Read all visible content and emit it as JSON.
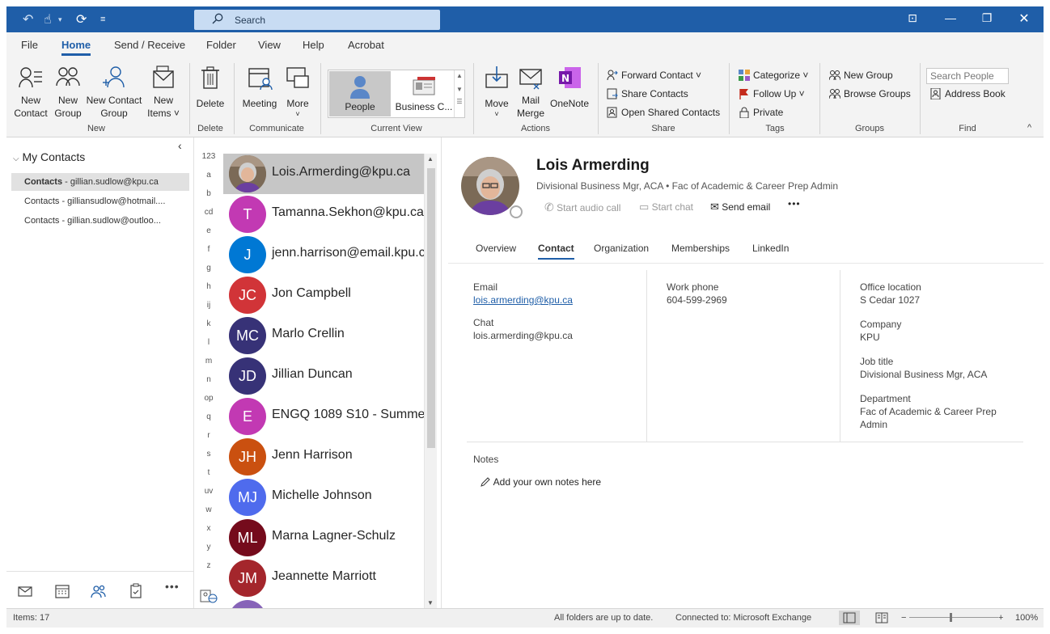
{
  "titlebar": {
    "search_placeholder": "Search"
  },
  "tabs": [
    "File",
    "Home",
    "Send / Receive",
    "Folder",
    "View",
    "Help",
    "Acrobat"
  ],
  "ribbon": {
    "new": {
      "new_contact": [
        "New",
        "Contact"
      ],
      "new_group": [
        "New",
        "Group"
      ],
      "new_contact_group": [
        "New Contact",
        "Group"
      ],
      "new_items": [
        "New",
        "Items ˅"
      ],
      "label": "New"
    },
    "delete": {
      "button": "Delete",
      "label": "Delete"
    },
    "communicate": {
      "meeting": "Meeting",
      "more": "More",
      "more_chevron": "˅",
      "label": "Communicate"
    },
    "current_view": {
      "people": "People",
      "business": "Business C...",
      "label": "Current View"
    },
    "actions": {
      "move": "Move",
      "move_chevron": "˅",
      "mail_merge": [
        "Mail",
        "Merge"
      ],
      "onenote": "OneNote",
      "label": "Actions"
    },
    "share": {
      "forward_contact": "Forward Contact ˅",
      "share_contacts": "Share Contacts",
      "open_shared": "Open Shared Contacts",
      "label": "Share"
    },
    "tags": {
      "categorize": "Categorize ˅",
      "follow_up": "Follow Up ˅",
      "private": "Private",
      "label": "Tags"
    },
    "groups": {
      "new_group": "New Group",
      "browse_groups": "Browse Groups",
      "label": "Groups"
    },
    "find": {
      "search_people": "Search People",
      "address_book": "Address Book",
      "label": "Find"
    },
    "collapse": "^"
  },
  "folder_pane": {
    "collapse_icon": "‹",
    "title": "My Contacts",
    "items": [
      {
        "bold": "Contacts",
        "rest": " - gillian.sudlow@kpu.ca",
        "selected": true
      },
      {
        "bold": "",
        "rest": "Contacts - gilliansudlow@hotmail....",
        "selected": false
      },
      {
        "bold": "",
        "rest": "Contacts - gillian.sudlow@outloo...",
        "selected": false
      }
    ]
  },
  "alpha_index": [
    "123",
    "a",
    "b",
    "cd",
    "e",
    "f",
    "g",
    "h",
    "ij",
    "k",
    "l",
    "m",
    "n",
    "op",
    "q",
    "r",
    "s",
    "t",
    "uv",
    "w",
    "x",
    "y",
    "z"
  ],
  "contacts": [
    {
      "initials": "",
      "name": "Lois.Armerding@kpu.ca",
      "color": "#8a7a6a",
      "photo": true,
      "selected": true
    },
    {
      "initials": "T",
      "name": "Tamanna.Sekhon@kpu.ca",
      "color": "#c239b3",
      "photo": false,
      "selected": false
    },
    {
      "initials": "J",
      "name": "jenn.harrison@email.kpu.ca",
      "color": "#0078d4",
      "photo": false,
      "selected": false
    },
    {
      "initials": "JC",
      "name": "Jon Campbell",
      "color": "#d13438",
      "photo": false,
      "selected": false
    },
    {
      "initials": "MC",
      "name": "Marlo Crellin",
      "color": "#373277",
      "photo": false,
      "selected": false
    },
    {
      "initials": "JD",
      "name": "Jillian Duncan",
      "color": "#373277",
      "photo": false,
      "selected": false
    },
    {
      "initials": "E",
      "name": "ENGQ 1089 S10 - Summer",
      "color": "#c239b3",
      "photo": false,
      "selected": false
    },
    {
      "initials": "JH",
      "name": "Jenn Harrison",
      "color": "#ca5010",
      "photo": false,
      "selected": false
    },
    {
      "initials": "MJ",
      "name": "Michelle Johnson",
      "color": "#4f6bed",
      "photo": false,
      "selected": false
    },
    {
      "initials": "ML",
      "name": "Marna Lagner-Schulz",
      "color": "#750b1c",
      "photo": false,
      "selected": false
    },
    {
      "initials": "JM",
      "name": "Jeannette Marriott",
      "color": "#a4262c",
      "photo": false,
      "selected": false
    },
    {
      "initials": "",
      "name": "",
      "color": "#8764b8",
      "photo": false,
      "selected": false
    }
  ],
  "contact_card": {
    "name": "Lois Armerding",
    "subtitle": "Divisional Business Mgr, ACA • Fac of Academic & Career Prep Admin",
    "actions": {
      "audio": "Start audio call",
      "chat": "Start chat",
      "email": "Send email",
      "more": "•••"
    },
    "tabs": [
      "Overview",
      "Contact",
      "Organization",
      "Memberships",
      "LinkedIn"
    ],
    "active_tab": "Contact",
    "email_label": "Email",
    "email_value": "lois.armerding@kpu.ca",
    "chat_label": "Chat",
    "chat_value": "lois.armerding@kpu.ca",
    "work_phone_label": "Work phone",
    "work_phone_value": "604-599-2969",
    "office_label": "Office location",
    "office_value": "S Cedar 1027",
    "company_label": "Company",
    "company_value": "KPU",
    "job_label": "Job title",
    "job_value": "Divisional Business Mgr, ACA",
    "dept_label": "Department",
    "dept_value": [
      "Fac of Academic & Career Prep",
      "Admin"
    ],
    "notes_label": "Notes",
    "notes_placeholder": "Add your own notes here"
  },
  "status_bar": {
    "items": "Items: 17",
    "sync": "All folders are up to date.",
    "connection": "Connected to: Microsoft Exchange",
    "zoom_minus": "−",
    "zoom_plus": "+",
    "zoom": "100%"
  },
  "colors": {
    "brand_blue": "#1f5ea8",
    "titlebar": "#1f5ea8",
    "ribbon_bg": "#f3f3f3",
    "selection": "#c6c6c6"
  },
  "icons": [
    "undo-icon",
    "touch-mode-icon",
    "sync-icon",
    "customize-qat-icon",
    "search-icon",
    "minimize-icon",
    "restore-icon",
    "close-icon"
  ]
}
